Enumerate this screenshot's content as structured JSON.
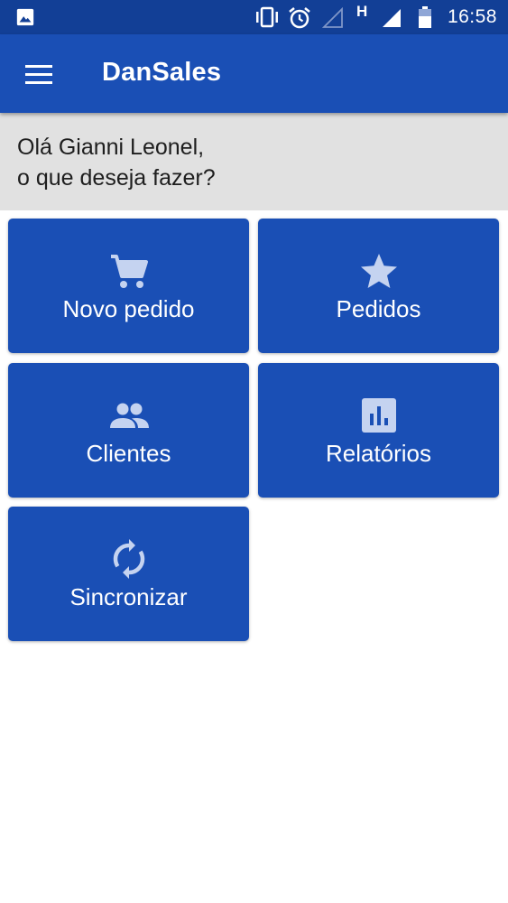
{
  "status_bar": {
    "time": "16:58",
    "network_label": "H",
    "icons": [
      "image-icon",
      "vibrate-icon",
      "alarm-icon",
      "signal-empty-icon",
      "signal-icon",
      "battery-icon"
    ]
  },
  "app_bar": {
    "title": "DanSales",
    "menu_icon": "menu-icon"
  },
  "greeting": {
    "line1": "Olá Gianni Leonel,",
    "line2": "o que deseja fazer?"
  },
  "tiles": [
    {
      "label": "Novo pedido",
      "icon": "cart-icon"
    },
    {
      "label": "Pedidos",
      "icon": "star-icon"
    },
    {
      "label": "Clientes",
      "icon": "people-icon"
    },
    {
      "label": "Relatórios",
      "icon": "chart-icon"
    },
    {
      "label": "Sincronizar",
      "icon": "sync-icon"
    }
  ],
  "colors": {
    "status_bar": "#123f96",
    "primary": "#1a4fb5",
    "greeting_bg": "#e1e1e1",
    "tile_icon": "#c5d3f0"
  }
}
